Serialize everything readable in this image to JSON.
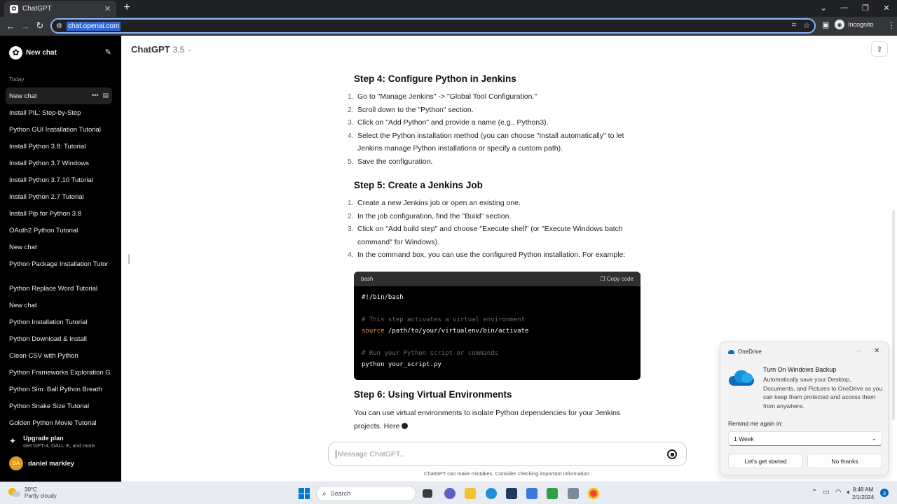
{
  "browser": {
    "tab_title": "ChatGPT",
    "new_tab_icon": "+",
    "url": "chat.openai.com",
    "profile_label": "Incognito"
  },
  "sidebar": {
    "new_chat_label": "New chat",
    "section_today": "Today",
    "items": [
      {
        "label": "New chat",
        "active": true
      },
      {
        "label": "Install PIL: Step-by-Step"
      },
      {
        "label": "Python GUI Installation Tutorial"
      },
      {
        "label": "Install Python 3.8: Tutorial"
      },
      {
        "label": "Install Python 3.7 Windows"
      },
      {
        "label": "Install Python 3.7.10 Tutorial"
      },
      {
        "label": "Install Python 2.7 Tutorial"
      },
      {
        "label": "Install Pip for Python 3.8"
      },
      {
        "label": "OAuth2 Python Tutorial"
      },
      {
        "label": "New chat"
      },
      {
        "label": "Python Package Installation Tutor"
      }
    ],
    "items2": [
      {
        "label": "Python Replace Word Tutorial"
      },
      {
        "label": "New chat"
      },
      {
        "label": "Python Installation Tutorial"
      },
      {
        "label": "Python Download & Install"
      },
      {
        "label": "Clean CSV with Python"
      },
      {
        "label": "Python Frameworks Exploration G"
      },
      {
        "label": "Python Sim: Ball Python Breath"
      },
      {
        "label": "Python Snake Size Tutorial"
      },
      {
        "label": "Golden Python Movie Tutorial"
      }
    ],
    "upgrade_title": "Upgrade plan",
    "upgrade_sub": "Get GPT-4, DALL·E, and more",
    "user_initials": "DA",
    "user_name": "daniel markley"
  },
  "header": {
    "model_name": "ChatGPT",
    "model_version": "3.5"
  },
  "content": {
    "step4": {
      "title": "Step 4: Configure Python in Jenkins",
      "items": [
        {
          "num": "1.",
          "text": "Go to \"Manage Jenkins\" -> \"Global Tool Configuration.\""
        },
        {
          "num": "2.",
          "text": "Scroll down to the \"Python\" section."
        },
        {
          "num": "3.",
          "text": "Click on \"Add Python\" and provide a name (e.g., Python3)."
        },
        {
          "num": "4.",
          "text": "Select the Python installation method (you can choose \"Install automatically\" to let Jenkins manage Python installations or specify a custom path)."
        },
        {
          "num": "5.",
          "text": "Save the configuration."
        }
      ]
    },
    "step5": {
      "title": "Step 5: Create a Jenkins Job",
      "items": [
        {
          "num": "1.",
          "text": "Create a new Jenkins job or open an existing one."
        },
        {
          "num": "2.",
          "text": "In the job configuration, find the \"Build\" section."
        },
        {
          "num": "3.",
          "text": "Click on \"Add build step\" and choose \"Execute shell\" (or \"Execute Windows batch command\" for Windows)."
        },
        {
          "num": "4.",
          "text": "In the command box, you can use the configured Python installation. For example:"
        }
      ]
    },
    "code": {
      "language": "bash",
      "copy_label": "Copy code",
      "line1": "#!/bin/bash",
      "comment1": "# This step activates a virtual environment",
      "kw_source": "source",
      "source_path": " /path/to/your/virtualenv/bin/activate",
      "comment2": "# Run your Python script or commands",
      "run_line": "python your_script.py"
    },
    "step6": {
      "title": "Step 6: Using Virtual Environments",
      "para": "You can use virtual environments to isolate Python dependencies for your Jenkins projects. Here"
    }
  },
  "composer": {
    "placeholder": "Message ChatGPT...",
    "disclaimer": "ChatGPT can make mistakes. Consider checking important information."
  },
  "toast": {
    "app": "OneDrive",
    "title": "Turn On Windows Backup",
    "body": "Automatically save your Desktop, Documents, and Pictures to OneDrive so you can keep them protected and access them from anywhere.",
    "remind_label": "Remind me again in:",
    "remind_value": "1 Week",
    "primary_btn": "Let's get started",
    "secondary_btn": "No thanks"
  },
  "taskbar": {
    "temp": "30°C",
    "condition": "Partly cloudy",
    "search_label": "Search",
    "time": "8:48 AM",
    "date": "2/1/2024",
    "notification_count": "3"
  }
}
